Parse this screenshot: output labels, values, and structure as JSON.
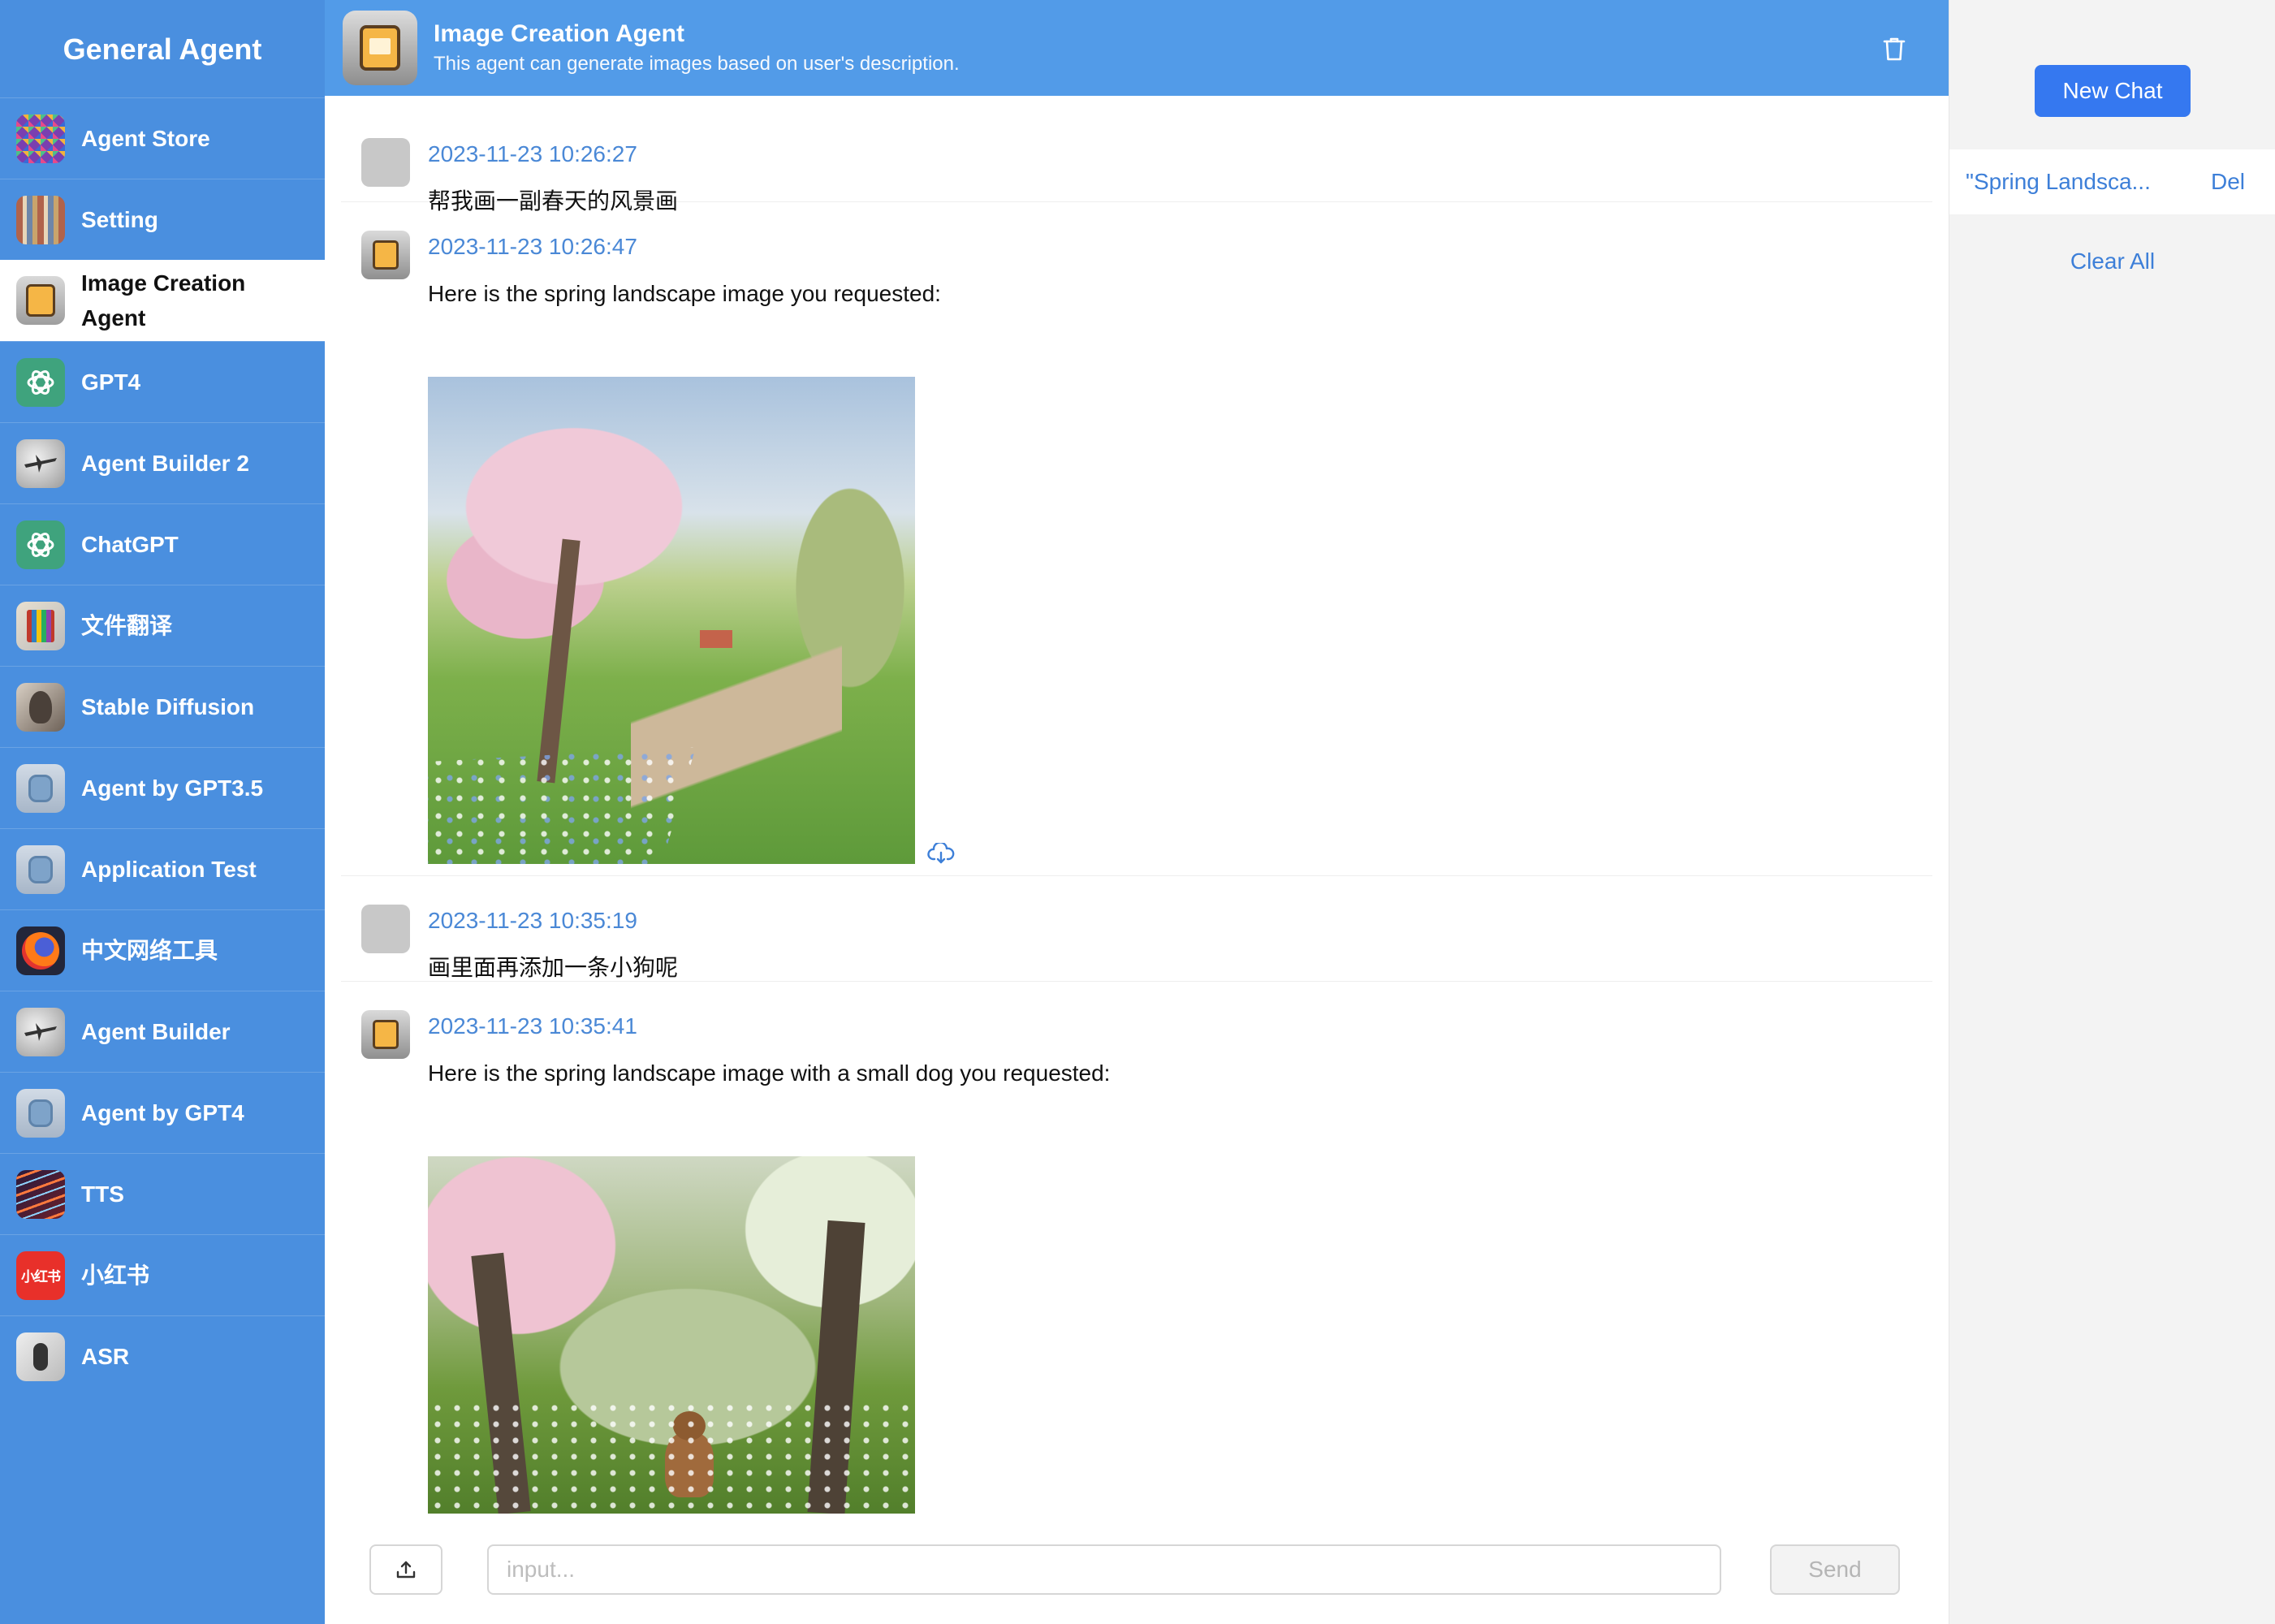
{
  "app": {
    "title": "General Agent"
  },
  "sidebar": {
    "items": [
      {
        "label": "Agent Store",
        "icon": "mosaic-avatar-icon",
        "active": false
      },
      {
        "label": "Setting",
        "icon": "bookshelf-avatar-icon",
        "active": false
      },
      {
        "label": "Image Creation Agent",
        "icon": "app-folder-avatar-icon",
        "active": true
      },
      {
        "label": "GPT4",
        "icon": "openai-logo-icon",
        "active": false
      },
      {
        "label": "Agent Builder 2",
        "icon": "airplane-avatar-icon",
        "active": false
      },
      {
        "label": "ChatGPT",
        "icon": "openai-logo-icon",
        "active": false
      },
      {
        "label": "文件翻译",
        "icon": "books-avatar-icon",
        "active": false
      },
      {
        "label": "Stable Diffusion",
        "icon": "portrait-avatar-icon",
        "active": false
      },
      {
        "label": "Agent by GPT3.5",
        "icon": "robot-avatar-icon",
        "active": false
      },
      {
        "label": "Application Test",
        "icon": "robot-avatar-icon",
        "active": false
      },
      {
        "label": "中文网络工具",
        "icon": "firefox-logo-icon",
        "active": false
      },
      {
        "label": "Agent Builder",
        "icon": "airplane-avatar-icon",
        "active": false
      },
      {
        "label": "Agent by GPT4",
        "icon": "robot-avatar-icon",
        "active": false
      },
      {
        "label": "TTS",
        "icon": "sound-wave-avatar-icon",
        "active": false
      },
      {
        "label": "小红书",
        "icon": "xiaohongshu-logo-icon",
        "logo_text": "小红书",
        "active": false
      },
      {
        "label": "ASR",
        "icon": "microphone-avatar-icon",
        "active": false
      }
    ]
  },
  "header": {
    "title": "Image Creation Agent",
    "description": "This agent can generate images based on user's description.",
    "delete_icon": "trash-icon"
  },
  "messages": [
    {
      "role": "user",
      "time": "2023-11-23 10:26:27",
      "text": "帮我画一副春天的风景画"
    },
    {
      "role": "agent",
      "time": "2023-11-23 10:26:47",
      "text": "Here is the spring landscape image you requested:",
      "image": "spring-landscape",
      "download_icon": "cloud-download-icon"
    },
    {
      "role": "user",
      "time": "2023-11-23 10:35:19",
      "text": "画里面再添加一条小狗呢"
    },
    {
      "role": "agent",
      "time": "2023-11-23 10:35:41",
      "text": "Here is the spring landscape image with a small dog you requested:",
      "image": "spring-landscape-with-dog"
    }
  ],
  "input": {
    "placeholder": "input...",
    "value": "",
    "send_label": "Send",
    "upload_icon": "upload-icon"
  },
  "right_panel": {
    "new_chat_label": "New Chat",
    "sessions": [
      {
        "title": "\"Spring Landsca...",
        "delete_label": "Del"
      }
    ],
    "clear_all_label": "Clear All"
  },
  "colors": {
    "sidebar_bg": "#4a8fdf",
    "header_bg": "#529be8",
    "accent_link": "#3d7fd8",
    "primary_button": "#3578f0",
    "timestamp": "#4a88d6"
  }
}
